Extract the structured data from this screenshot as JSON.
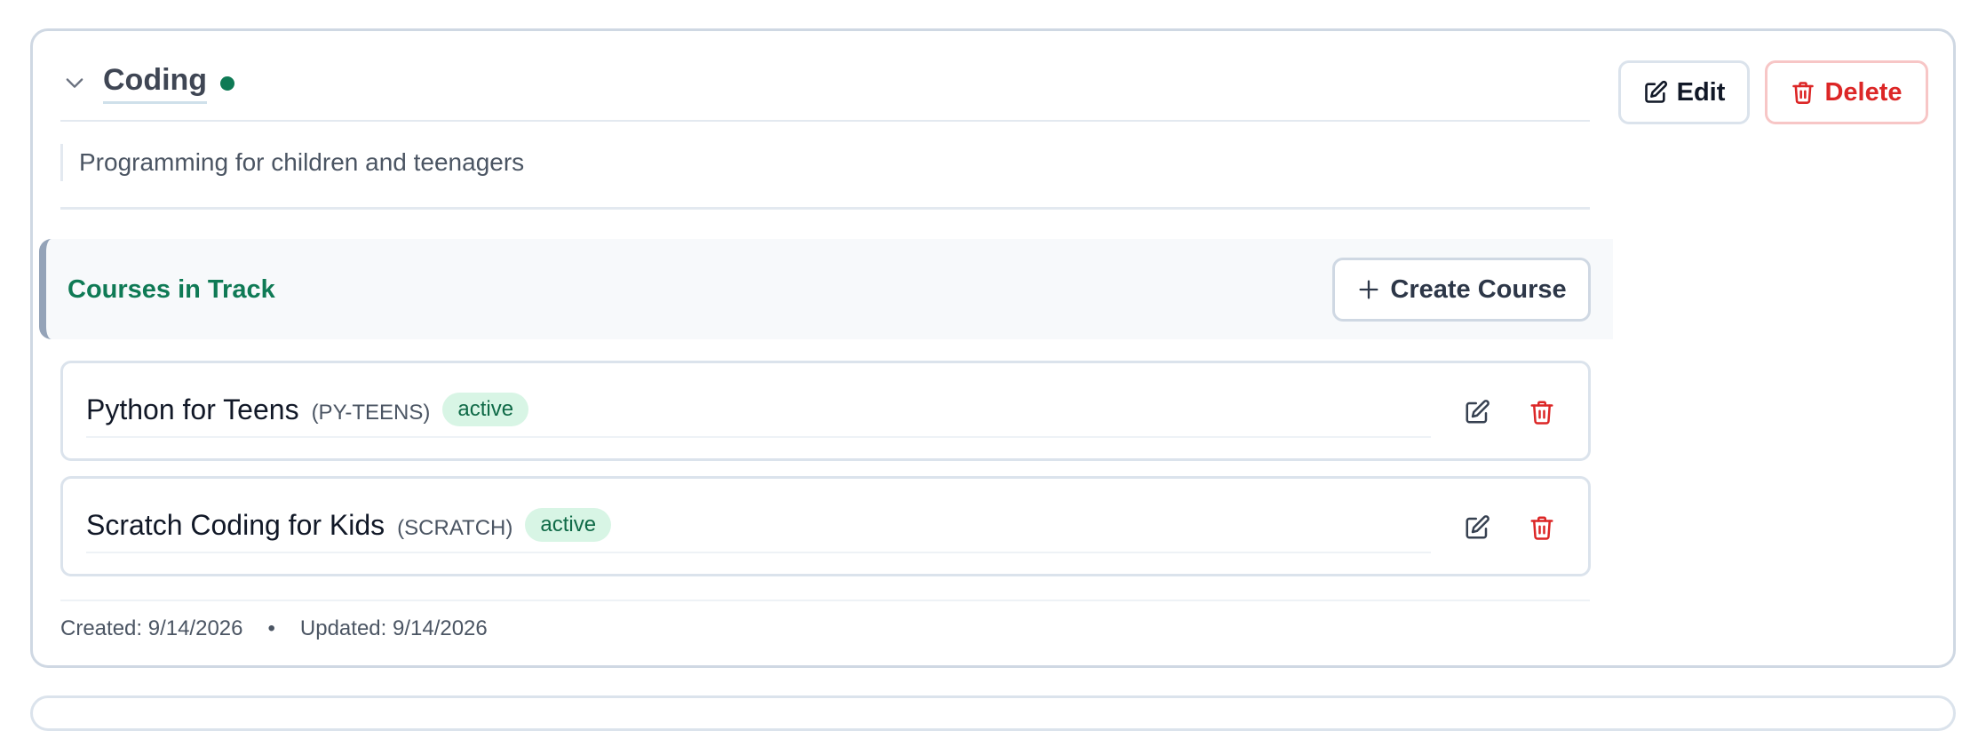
{
  "track": {
    "name": "Coding",
    "status_color": "#0f7a55",
    "description": "Programming for children and teenagers",
    "actions": {
      "edit_label": "Edit",
      "delete_label": "Delete"
    },
    "courses_section": {
      "title": "Courses in Track",
      "create_label": "Create Course"
    },
    "courses": [
      {
        "name": "Python for Teens",
        "code": "(PY-TEENS)",
        "status": "active"
      },
      {
        "name": "Scratch Coding for Kids",
        "code": "(SCRATCH)",
        "status": "active"
      }
    ],
    "meta": {
      "created": "Created: 9/14/2026",
      "separator": "•",
      "updated": "Updated: 9/14/2026"
    }
  },
  "icons": {
    "collapse": "chevron-down-icon",
    "edit": "pencil-square-icon",
    "delete": "trash-icon",
    "create": "plus-icon"
  },
  "colors": {
    "accent_green": "#0f7a55",
    "danger_red": "#dc2626",
    "badge_bg": "#d8f5e5",
    "border": "#cfd8e3"
  }
}
